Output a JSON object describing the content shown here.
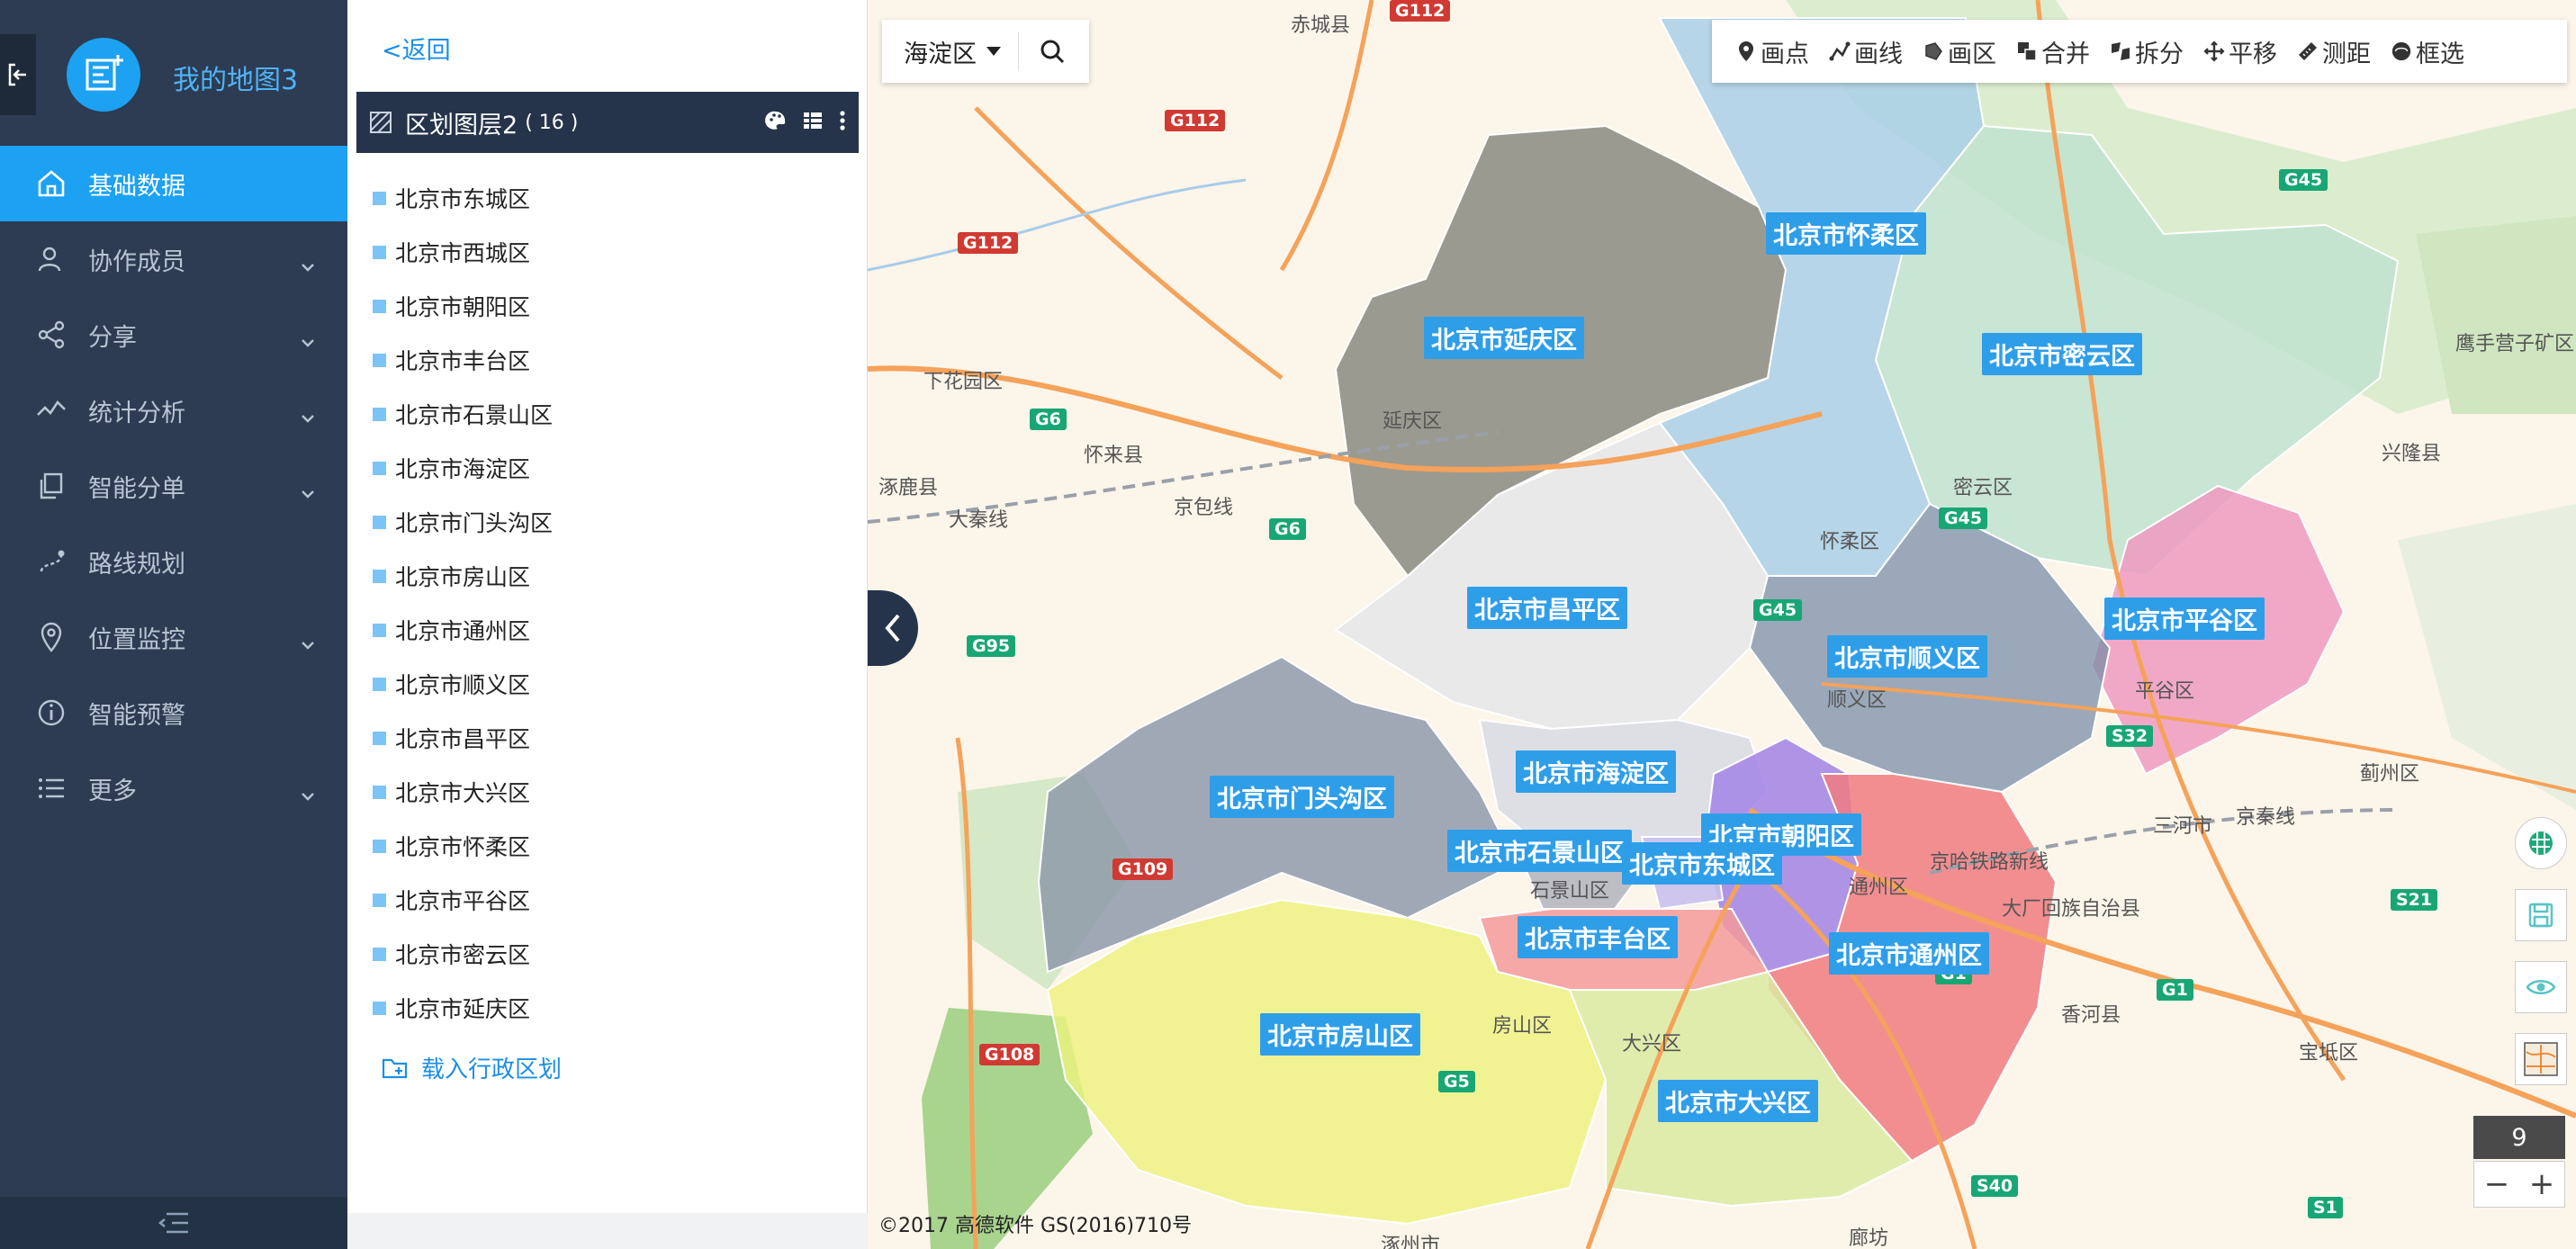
{
  "app": {
    "title": "我的地图3"
  },
  "nav": {
    "items": [
      {
        "label": "基础数据",
        "icon": "home-icon",
        "active": true
      },
      {
        "label": "协作成员",
        "icon": "user-icon",
        "expandable": true
      },
      {
        "label": "分享",
        "icon": "share-icon",
        "expandable": true
      },
      {
        "label": "统计分析",
        "icon": "chart-icon",
        "expandable": true
      },
      {
        "label": "智能分单",
        "icon": "copy-icon",
        "expandable": true
      },
      {
        "label": "路线规划",
        "icon": "route-icon"
      },
      {
        "label": "位置监控",
        "icon": "location-icon",
        "expandable": true
      },
      {
        "label": "智能预警",
        "icon": "info-icon"
      },
      {
        "label": "更多",
        "icon": "list-icon",
        "expandable": true
      }
    ]
  },
  "panel": {
    "back_label": "<返回",
    "layer_name": "区划图层2",
    "layer_count": "( 16 )",
    "districts": [
      "北京市东城区",
      "北京市西城区",
      "北京市朝阳区",
      "北京市丰台区",
      "北京市石景山区",
      "北京市海淀区",
      "北京市门头沟区",
      "北京市房山区",
      "北京市通州区",
      "北京市顺义区",
      "北京市昌平区",
      "北京市大兴区",
      "北京市怀柔区",
      "北京市平谷区",
      "北京市密云区",
      "北京市延庆区"
    ],
    "load_label": "载入行政区划"
  },
  "map": {
    "search_select": "海淀区",
    "tools": [
      "画点",
      "画线",
      "画区",
      "合并",
      "拆分",
      "平移",
      "测距",
      "框选"
    ],
    "zoom_level": "9",
    "zoom_out": "−",
    "zoom_in": "+",
    "copyright": "©2017 高德软件 GS(2016)710号",
    "district_labels": [
      "北京市怀柔区",
      "北京市延庆区",
      "北京市密云区",
      "北京市昌平区",
      "北京市平谷区",
      "北京市顺义区",
      "北京市海淀区",
      "北京市门头沟区",
      "北京市朝阳区",
      "北京市石景山区",
      "北京市东城区",
      "北京市丰台区",
      "北京市通州区",
      "北京市房山区",
      "北京市大兴区"
    ],
    "places": [
      "赤城县",
      "下花园区",
      "怀来县",
      "涿鹿县",
      "延庆区",
      "密云区",
      "兴隆县",
      "怀柔区",
      "平谷区",
      "顺义区",
      "蓟州区",
      "三河市",
      "大厂回族自治县",
      "通州区",
      "香河县",
      "宝坻区",
      "石景山区",
      "房山区",
      "大兴区",
      "廊坊",
      "涿州市",
      "鹰手营子矿区"
    ],
    "roads": [
      "G112",
      "G112",
      "G112",
      "G6",
      "G6",
      "G95",
      "G109",
      "G108",
      "G5",
      "G45",
      "G45",
      "G45",
      "G1",
      "G1",
      "S32",
      "S21",
      "S40",
      "S1",
      "大秦线",
      "京包线",
      "京哈铁路新线",
      "京秦线"
    ]
  },
  "colors": {
    "nav_bg": "#2d3c52",
    "accent": "#1da1f2",
    "label_bg": "#2f9ee9"
  }
}
